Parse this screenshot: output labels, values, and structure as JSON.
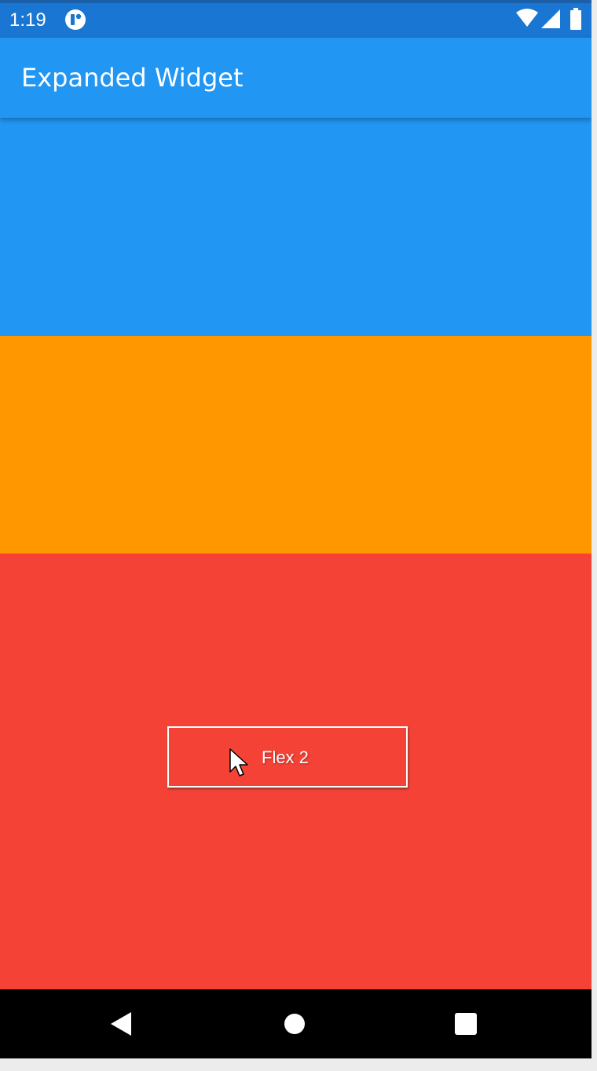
{
  "status_bar": {
    "time": "1:19",
    "app_icon": "app-notification-icon",
    "icons": [
      "wifi-icon",
      "signal-icon",
      "battery-icon"
    ],
    "color": "#1976D2"
  },
  "app_bar": {
    "title": "Expanded Widget",
    "color": "#2196F3"
  },
  "blocks": [
    {
      "color": "#2196F3"
    },
    {
      "color": "#FF9800"
    },
    {
      "color": "#F44336",
      "button_label": "Flex 2"
    }
  ],
  "nav_bar": {
    "icons": [
      "back-icon",
      "home-icon",
      "recents-icon"
    ]
  }
}
